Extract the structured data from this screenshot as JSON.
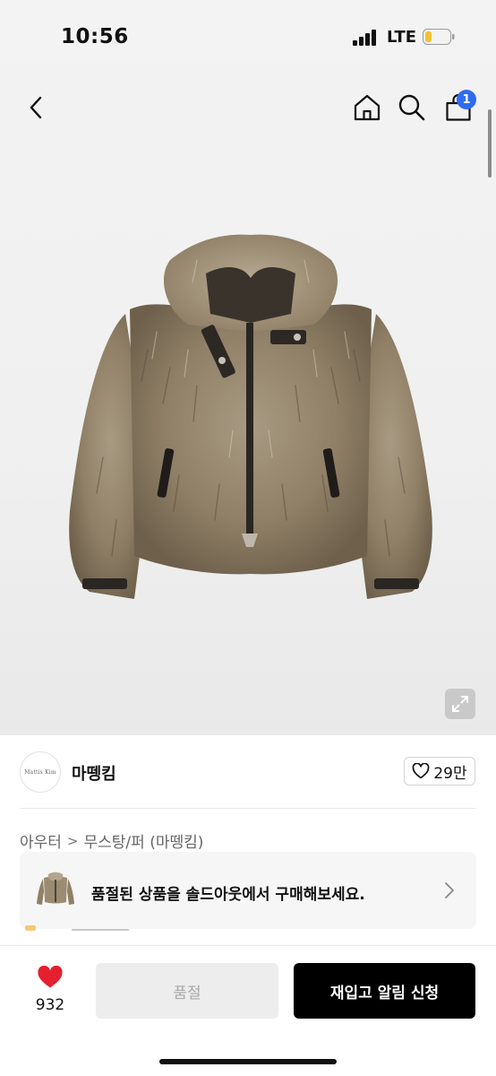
{
  "status_bar": {
    "time": "10:56",
    "network": "LTE"
  },
  "nav": {
    "cart_count": "1"
  },
  "seller": {
    "logo_text": "Mattis Kim",
    "name": "마뗑킴",
    "likes": "29만"
  },
  "breadcrumb": {
    "category": "아우터",
    "subcategory": "무스탕/퍼 (마뗑킴)"
  },
  "banner": {
    "text": "품절된 상품을 솔드아웃에서 구매해보세요."
  },
  "bottom_bar": {
    "wish_count": "932",
    "soldout_label": "품절",
    "restock_label": "재입고 알림 신청"
  },
  "colors": {
    "badge": "#2f6bf0",
    "heart": "#e5202e",
    "primary_button": "#000000",
    "disabled_button": "#ededed"
  }
}
